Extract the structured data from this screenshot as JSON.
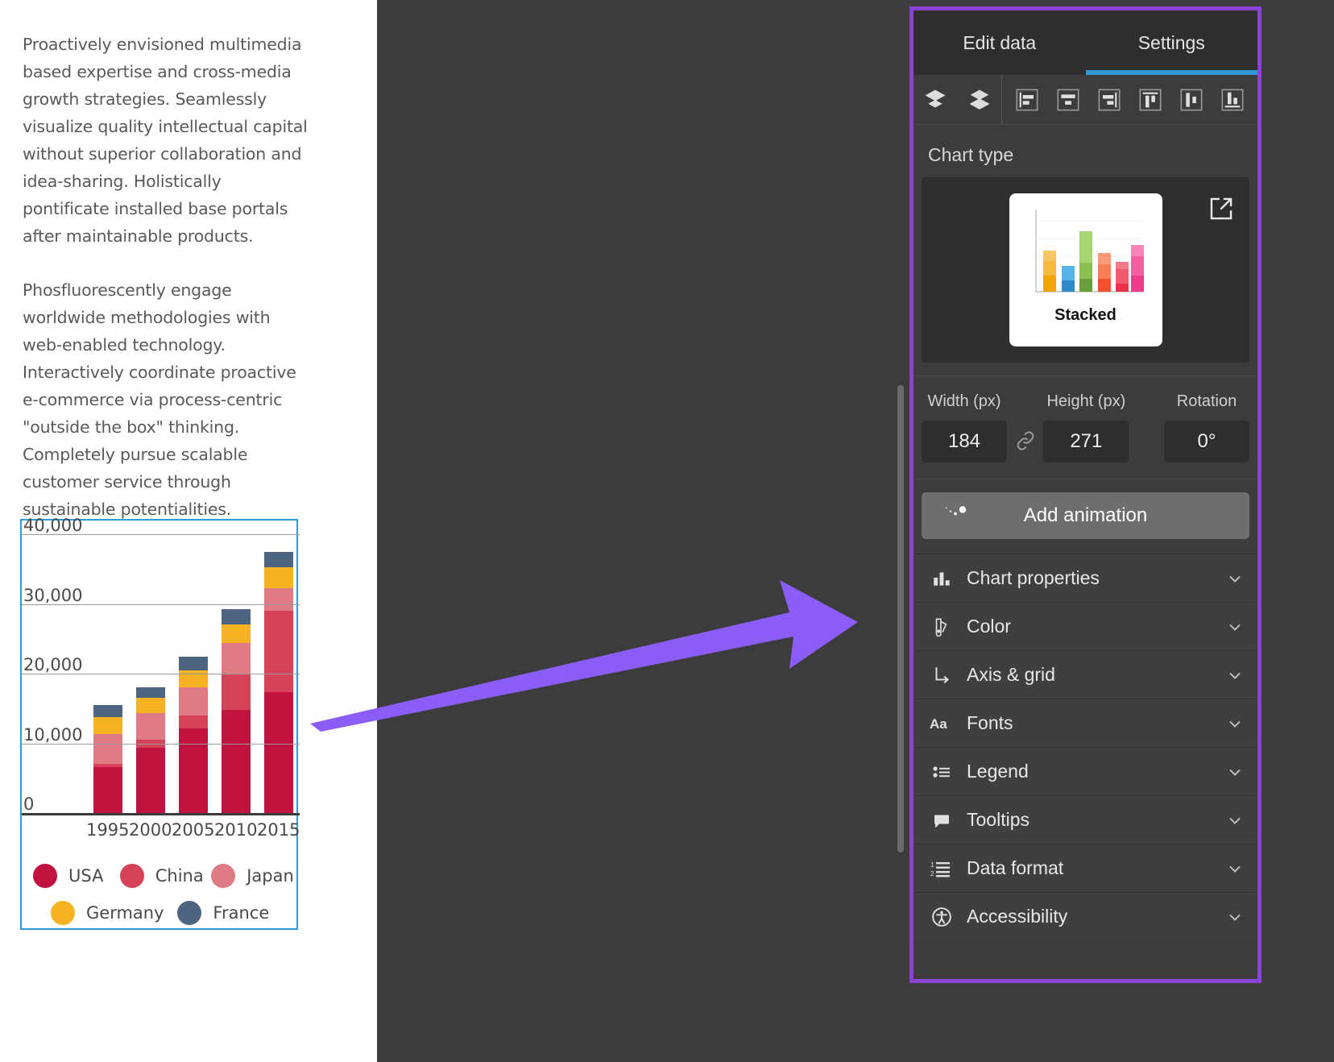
{
  "document": {
    "paragraphs": [
      "Proactively envisioned multimedia based expertise and cross-media growth strategies. Seamlessly visualize quality intellectual capital without superior collaboration and idea-sharing. Holistically pontificate installed base portals after maintainable products.",
      "Phosfluorescently engage worldwide methodologies with web-enabled technology. Interactively coordinate proactive e-commerce via process-centric \"outside the box\" thinking. Completely pursue scalable customer service through sustainable potentialities."
    ]
  },
  "chart_data": {
    "type": "bar",
    "subtype": "stacked",
    "title": "",
    "xlabel": "",
    "ylabel": "",
    "categories": [
      "1995",
      "2000",
      "2005",
      "2010",
      "2015"
    ],
    "ytick_labels": [
      "40,000",
      "30,000",
      "20,000",
      "10,000",
      "0"
    ],
    "ytick_values": [
      40000,
      30000,
      20000,
      10000,
      0
    ],
    "ylim": [
      0,
      42000
    ],
    "grid": true,
    "legend_position": "bottom",
    "series": [
      {
        "name": "USA",
        "color": "#c2123f",
        "values": [
          6600,
          9400,
          12200,
          14800,
          17300
        ]
      },
      {
        "name": "China",
        "color": "#d64257",
        "values": [
          500,
          1100,
          1800,
          5200,
          11700
        ]
      },
      {
        "name": "Japan",
        "color": "#e07b86",
        "values": [
          4200,
          3900,
          4100,
          4400,
          3300
        ]
      },
      {
        "name": "Germany",
        "color": "#f5b324",
        "values": [
          2500,
          2100,
          2400,
          2700,
          3000
        ]
      },
      {
        "name": "France",
        "color": "#4f6480",
        "values": [
          1700,
          1600,
          2000,
          2200,
          2200
        ]
      }
    ]
  },
  "panel": {
    "tabs": [
      {
        "label": "Edit data",
        "active": false
      },
      {
        "label": "Settings",
        "active": true
      }
    ],
    "toolbar": {
      "group_layers": [
        {
          "name": "bring-to-front-icon"
        },
        {
          "name": "send-to-back-icon"
        }
      ],
      "group_align": [
        {
          "name": "align-left-icon"
        },
        {
          "name": "align-center-horizontal-icon"
        },
        {
          "name": "align-right-icon"
        },
        {
          "name": "align-top-icon"
        },
        {
          "name": "align-middle-vertical-icon"
        },
        {
          "name": "align-bottom-icon"
        }
      ]
    },
    "chart_type": {
      "section_label": "Chart type",
      "selected": "Stacked",
      "edit_tooltip": "Edit chart type"
    },
    "dimensions": {
      "width_label": "Width (px)",
      "width_value": "184",
      "height_label": "Height (px)",
      "height_value": "271",
      "rotation_label": "Rotation",
      "rotation_value": "0°",
      "link_icon": "link-aspect-ratio-icon"
    },
    "add_animation": {
      "label": "Add animation",
      "icon": "animation-icon"
    },
    "accordion": [
      {
        "label": "Chart properties",
        "icon": "bar-chart-icon"
      },
      {
        "label": "Color",
        "icon": "color-palette-icon"
      },
      {
        "label": "Axis & grid",
        "icon": "axis-grid-icon"
      },
      {
        "label": "Fonts",
        "icon": "fonts-aa-icon"
      },
      {
        "label": "Legend",
        "icon": "legend-list-icon"
      },
      {
        "label": "Tooltips",
        "icon": "tooltip-bubble-icon"
      },
      {
        "label": "Data format",
        "icon": "number-list-icon"
      },
      {
        "label": "Accessibility",
        "icon": "accessibility-icon"
      }
    ]
  },
  "colors": {
    "accent_highlight": "#8b43d6",
    "tab_underline": "#2f97d4",
    "selection_border": "#2d9cdb",
    "panel_bg": "#3c3c3c",
    "arrow": "#8b5cf6"
  }
}
